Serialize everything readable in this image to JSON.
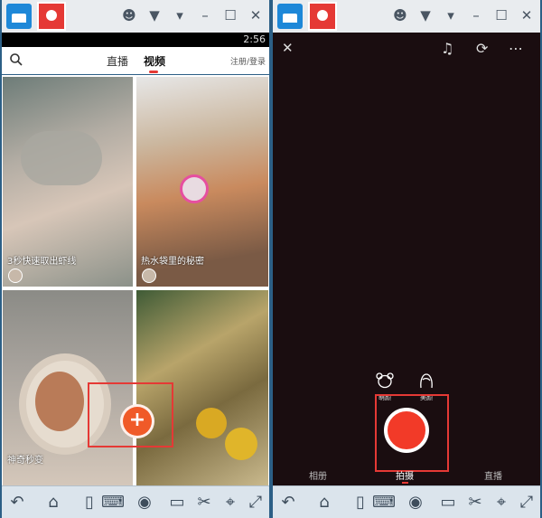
{
  "left_window": {
    "status_time": "2:56",
    "header": {
      "tabs": [
        {
          "label": "直播",
          "active": false
        },
        {
          "label": "视频",
          "active": true
        }
      ],
      "login_label": "注册/登录"
    },
    "videos": [
      {
        "caption": "3秒快速取出虾线"
      },
      {
        "caption": "热水袋里的秘密"
      },
      {
        "caption": "神奇秒变"
      },
      {
        "caption": ""
      }
    ],
    "fab_label": "+"
  },
  "right_window": {
    "filters": [
      {
        "label": "萌颜"
      },
      {
        "label": "美颜"
      }
    ],
    "modes": [
      {
        "label": "相册",
        "active": false
      },
      {
        "label": "拍摄",
        "active": true
      },
      {
        "label": "直播",
        "active": false
      }
    ]
  },
  "colors": {
    "accent": "#e53935",
    "record": "#f23a28",
    "toolbar": "#e9ecef",
    "navbar": "#dbe4ec"
  },
  "icons": [
    "home-icon",
    "app-icon",
    "user-icon",
    "shirt-icon",
    "dropdown-icon",
    "minimize-icon",
    "maximize-icon",
    "close-icon",
    "back-icon",
    "home-nav-icon",
    "recent-icon",
    "keyboard-icon",
    "eye-icon",
    "phone-icon",
    "scissors-icon",
    "location-icon",
    "fullscreen-icon",
    "search-icon",
    "music-icon",
    "flip-camera-icon",
    "more-icon"
  ]
}
